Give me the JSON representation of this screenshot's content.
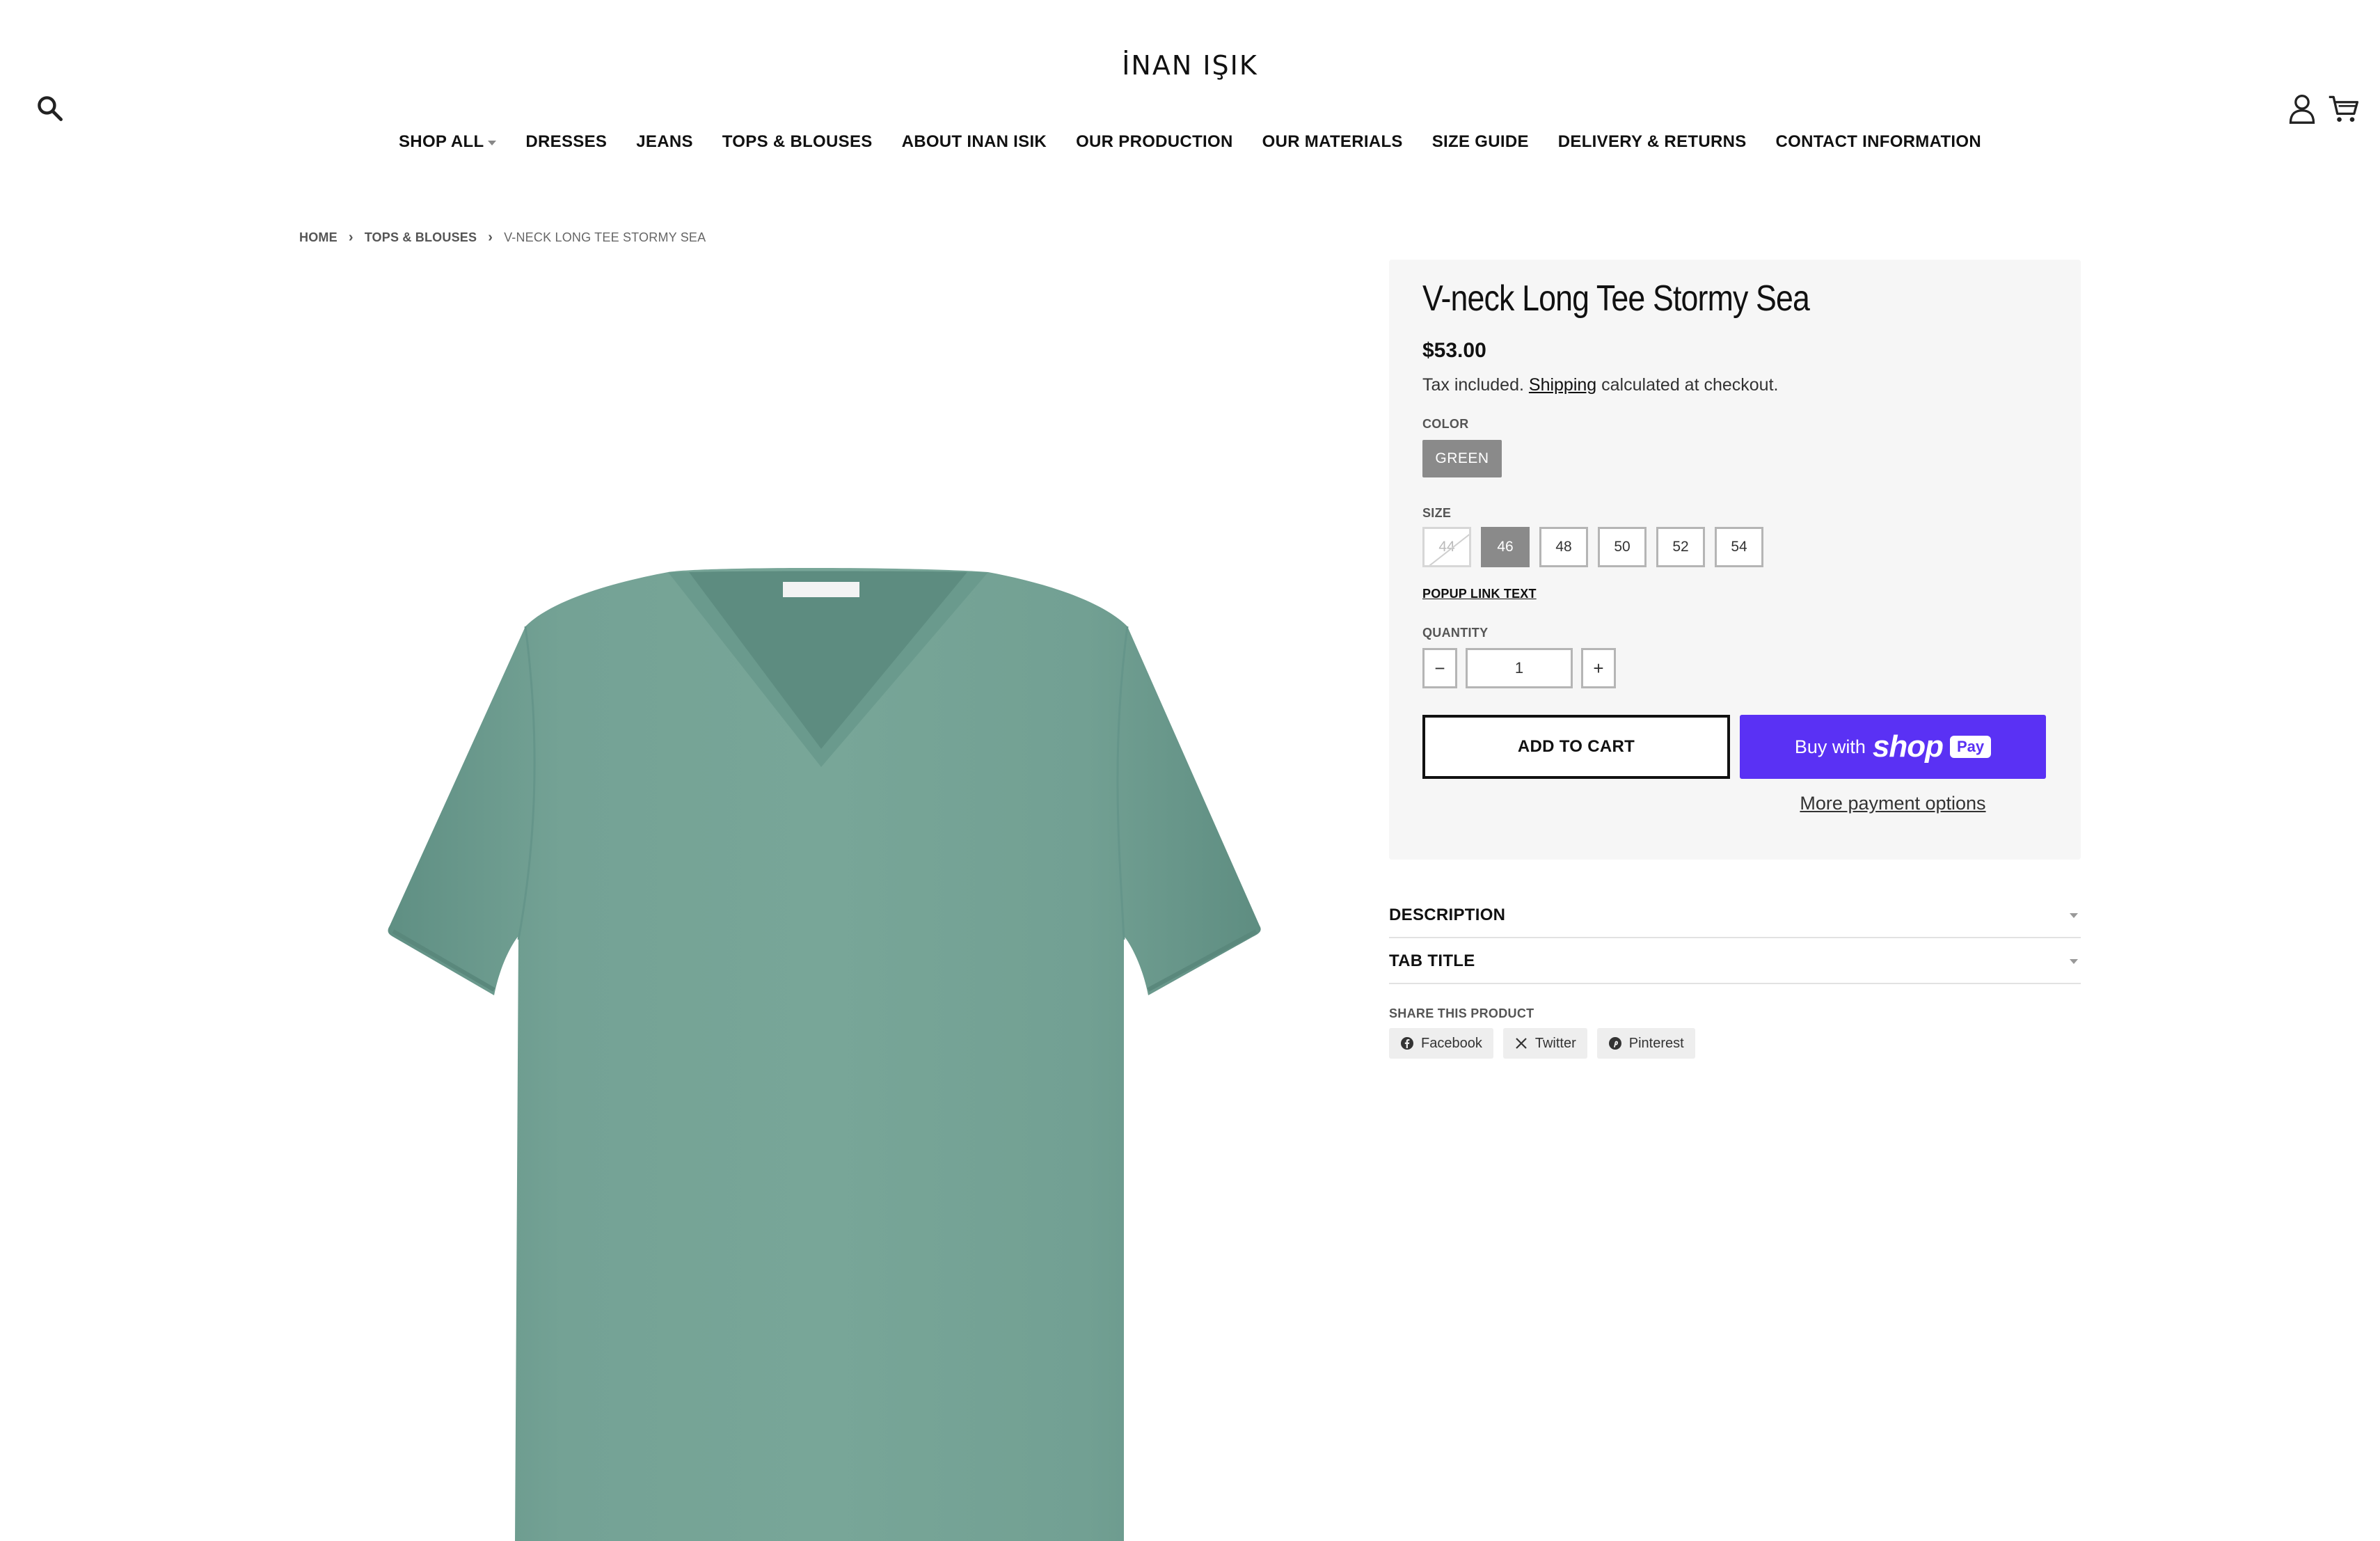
{
  "header": {
    "logo": "İNAN IŞIK",
    "icons": {
      "search": "search-icon",
      "account": "account-icon",
      "cart": "cart-icon"
    }
  },
  "nav": {
    "items": [
      {
        "label": "SHOP ALL",
        "has_dropdown": true
      },
      {
        "label": "DRESSES"
      },
      {
        "label": "JEANS"
      },
      {
        "label": "TOPS & BLOUSES"
      },
      {
        "label": "ABOUT INAN ISIK"
      },
      {
        "label": "OUR PRODUCTION"
      },
      {
        "label": "OUR MATERIALS"
      },
      {
        "label": "SIZE GUIDE"
      },
      {
        "label": "DELIVERY & RETURNS"
      },
      {
        "label": "CONTACT INFORMATION"
      }
    ]
  },
  "breadcrumb": {
    "home": "HOME",
    "category": "TOPS & BLOUSES",
    "current": "V-NECK LONG TEE STORMY SEA",
    "separator": "›"
  },
  "product": {
    "title": "V-neck Long Tee Stormy Sea",
    "price": "$53.00",
    "tax_prefix": "Tax included.",
    "tax_link": "Shipping",
    "tax_suffix": "calculated at checkout.",
    "color_label": "COLOR",
    "color_value": "GREEN",
    "size_label": "SIZE",
    "sizes": [
      "44",
      "46",
      "48",
      "50",
      "52",
      "54"
    ],
    "selected_size": "46",
    "unavailable_sizes": [
      "44"
    ],
    "popup_link": "POPUP LINK TEXT",
    "quantity_label": "QUANTITY",
    "quantity": "1",
    "qty_minus": "−",
    "qty_plus": "+",
    "add_to_cart": "ADD TO CART",
    "shoppay_buy": "Buy with",
    "shoppay_shop": "shop",
    "shoppay_pay": "Pay",
    "more_payment": "More payment options",
    "tee_color": "#6f9e91"
  },
  "accordions": [
    {
      "title": "DESCRIPTION"
    },
    {
      "title": "TAB TITLE"
    }
  ],
  "share": {
    "label": "SHARE THIS PRODUCT",
    "buttons": [
      {
        "label": "Facebook",
        "icon": "facebook-icon"
      },
      {
        "label": "Twitter",
        "icon": "x-icon"
      },
      {
        "label": "Pinterest",
        "icon": "pinterest-icon"
      }
    ]
  },
  "colors": {
    "shoppay": "#5a31f4",
    "panel_bg": "#f6f6f6",
    "selected_swatch": "#8a8a8a"
  }
}
